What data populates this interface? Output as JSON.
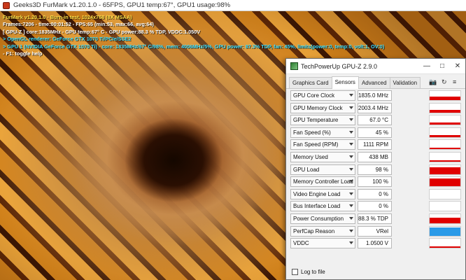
{
  "furmark": {
    "window_title": "Geeks3D FurMark v1.20.1.0 - 65FPS, GPU1 temp:67°, GPU1 usage:98%",
    "osd_lines": [
      {
        "text": "FurMark v1.20.1.0 - Burn-in test, 1024x768 (8X MSAA)",
        "color": "yellow"
      },
      {
        "text": "Frames:7206 - time:00:01:52 - FPS:65 (min:53, max:66, avg:64)",
        "color": "white"
      },
      {
        "text": "[ GPU-Z ] core:1835MHz - GPU temp:67° C - GPU power:88.3 % TDP, VDDC:1.050V",
        "color": "white"
      },
      {
        "text": "> OpenGL renderer: GeForce GTX 1070 Ti/PCIe/SSE2",
        "color": "cyan"
      },
      {
        "text": "> GPU 1 (NVIDIA GeForce GTX 1070 Ti) - core: 1835MHz/67° C/98%, mem: 4006MHz/5%, GPU power: 87.3% TDP, fan: 45%, limits(power:0, temp:0, volt:1, OV:0)",
        "color": "cyan"
      },
      {
        "text": "- F1: toggle help",
        "color": "white"
      }
    ]
  },
  "gpuz": {
    "window_title": "TechPowerUp GPU-Z 2.9.0",
    "controls": {
      "minimize": "—",
      "maximize": "□",
      "close": "✕"
    },
    "tabs": [
      {
        "label": "Graphics Card",
        "active": false
      },
      {
        "label": "Sensors",
        "active": true
      },
      {
        "label": "Advanced",
        "active": false
      },
      {
        "label": "Validation",
        "active": false
      }
    ],
    "tools": {
      "camera": "📷",
      "refresh": "↻",
      "menu": "≡"
    },
    "sensors": [
      {
        "name": "GPU Core Clock",
        "value": "1835.0 MHz",
        "level": 0.35,
        "color": "#e00000"
      },
      {
        "name": "GPU Memory Clock",
        "value": "2003.4 MHz",
        "level": 0.3,
        "color": "#e00000"
      },
      {
        "name": "GPU Temperature",
        "value": "67.0 °C",
        "level": 0.25,
        "color": "#e00000"
      },
      {
        "name": "Fan Speed (%)",
        "value": "45 %",
        "level": 0.2,
        "color": "#e00000"
      },
      {
        "name": "Fan Speed (RPM)",
        "value": "1111 RPM",
        "level": 0.2,
        "color": "#e00000"
      },
      {
        "name": "Memory Used",
        "value": "438 MB",
        "level": 0.15,
        "color": "#e00000"
      },
      {
        "name": "GPU Load",
        "value": "98 %",
        "level": 0.75,
        "color": "#e00000"
      },
      {
        "name": "Memory Controller Load",
        "value": "100 %",
        "level": 0.85,
        "color": "#e00000"
      },
      {
        "name": "Video Engine Load",
        "value": "0 %",
        "level": 0,
        "color": "#e00000"
      },
      {
        "name": "Bus Interface Load",
        "value": "0 %",
        "level": 0,
        "color": "#e00000"
      },
      {
        "name": "Power Consumption",
        "value": "88.3 % TDP",
        "level": 0.6,
        "color": "#e00000"
      },
      {
        "name": "PerfCap Reason",
        "value": "VRel",
        "level": 0.85,
        "color": "#2b9be8"
      },
      {
        "name": "VDDC",
        "value": "1.0500 V",
        "level": 0.2,
        "color": "#e00000"
      }
    ],
    "log_to_file_label": "Log to file",
    "log_to_file_checked": false
  }
}
